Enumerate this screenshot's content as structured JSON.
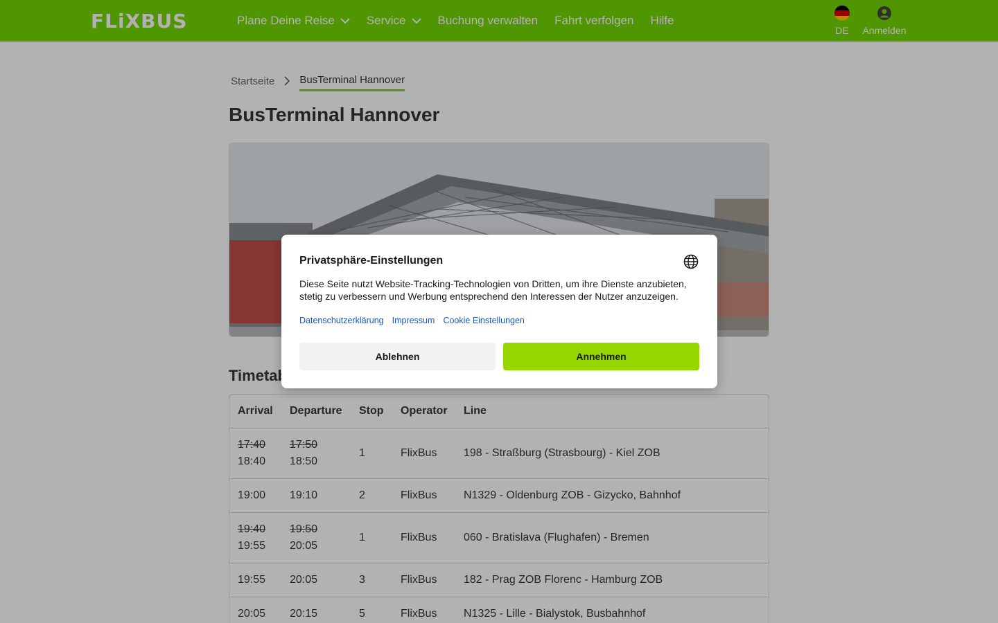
{
  "header": {
    "logo": "FLiXBUS",
    "nav": [
      {
        "label": "Plane Deine Reise",
        "has_dropdown": true
      },
      {
        "label": "Service",
        "has_dropdown": true
      },
      {
        "label": "Buchung verwalten",
        "has_dropdown": false
      },
      {
        "label": "Fahrt verfolgen",
        "has_dropdown": false
      },
      {
        "label": "Hilfe",
        "has_dropdown": false
      }
    ],
    "language": "DE",
    "login": "Anmelden"
  },
  "breadcrumb": {
    "home": "Startseite",
    "current": "BusTerminal Hannover"
  },
  "page_title": "BusTerminal Hannover",
  "timetable": {
    "title": "Timetable",
    "columns": [
      "Arrival",
      "Departure",
      "Stop",
      "Operator",
      "Line"
    ],
    "rows": [
      {
        "arrival_old": "17:40",
        "arrival": "18:40",
        "departure_old": "17:50",
        "departure": "18:50",
        "stop": "1",
        "operator": "FlixBus",
        "line": "198 - Straßburg (Strasbourg) - Kiel ZOB"
      },
      {
        "arrival_old": "",
        "arrival": "19:00",
        "departure_old": "",
        "departure": "19:10",
        "stop": "2",
        "operator": "FlixBus",
        "line": "N1329 - Oldenburg ZOB - Gizycko, Bahnhof"
      },
      {
        "arrival_old": "19:40",
        "arrival": "19:55",
        "departure_old": "19:50",
        "departure": "20:05",
        "stop": "1",
        "operator": "FlixBus",
        "line": "060 - Bratislava (Flughafen) - Bremen"
      },
      {
        "arrival_old": "",
        "arrival": "19:55",
        "departure_old": "",
        "departure": "20:05",
        "stop": "3",
        "operator": "FlixBus",
        "line": "182 - Prag ZOB Florenc - Hamburg ZOB"
      },
      {
        "arrival_old": "",
        "arrival": "20:05",
        "departure_old": "",
        "departure": "20:15",
        "stop": "5",
        "operator": "FlixBus",
        "line": "N1325 - Lille - Bialystok, Busbahnhof"
      }
    ]
  },
  "consent": {
    "title": "Privatsphäre-Einstellungen",
    "text": "Diese Seite nutzt Website-Tracking-Technologien von Dritten, um ihre Dienste anzubieten, stetig zu verbessern und Werbung entsprechend den Interessen der Nutzer anzuzeigen.",
    "links": [
      "Datenschutzerklärung",
      "Impressum",
      "Cookie Einstellungen"
    ],
    "decline": "Ablehnen",
    "accept": "Annehmen"
  },
  "colors": {
    "brand_green": "#73d700",
    "accept_green": "#97d700",
    "link_blue": "#1a56b4"
  }
}
